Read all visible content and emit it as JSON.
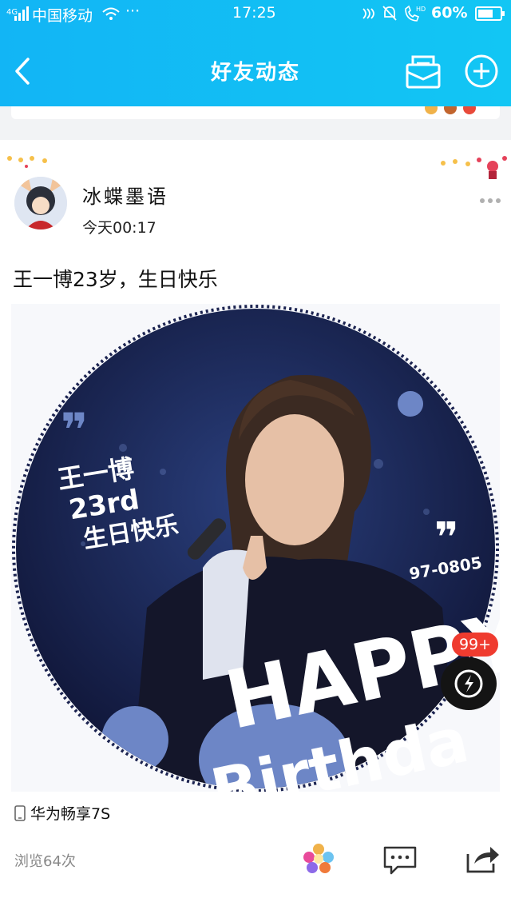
{
  "status_bar": {
    "network": "4G",
    "carrier": "中国移动",
    "dots": "···",
    "time": "17:25",
    "battery": "60%"
  },
  "nav": {
    "title": "好友动态",
    "back_icon": "chevron-left-icon",
    "mail_icon": "mail-icon",
    "add_icon": "plus-circle-icon"
  },
  "post": {
    "username": "冰蝶墨语",
    "time": "今天00:17",
    "text": "王一博23岁，生日快乐",
    "image": {
      "quote_text_lines": [
        "王一博",
        "23rd",
        "生日快乐"
      ],
      "code": "97-0805",
      "happy": "HAPPY",
      "birthday": "Birthda"
    },
    "device": "华为畅享7S",
    "views": "浏览64次"
  },
  "floating": {
    "badge": "99+",
    "icon": "lightning-chat-icon"
  },
  "colors": {
    "header": "#12b5f5",
    "badge": "#ef3b2f",
    "image_navy": "#1b2350",
    "image_blue": "#6d86c6"
  }
}
